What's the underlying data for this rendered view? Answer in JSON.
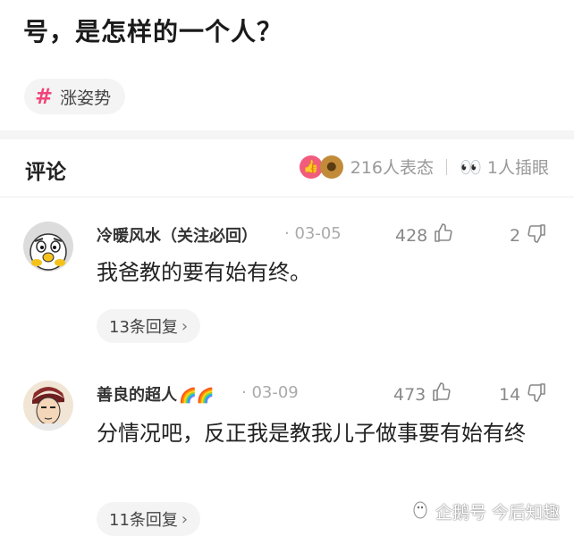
{
  "post": {
    "title": "号，是怎样的一个人？"
  },
  "tag": {
    "icon": "hash-icon",
    "label": "涨姿势"
  },
  "comments_header": {
    "title": "评论",
    "reaction_count": "216人表态",
    "insert_eye_count": "1人插眼"
  },
  "comments": [
    {
      "user": "冷暖风水（关注必回）",
      "date": "· 03-05",
      "likes": "428",
      "dislikes": "2",
      "text": "我爸教的要有始有终。",
      "replies": "13条回复",
      "avatar_icon": "cartoon-chick-avatar"
    },
    {
      "user": "善良的超人",
      "date": "· 03-09",
      "likes": "473",
      "dislikes": "14",
      "text": "分情况吧，反正我是教我儿子做事要有始有终",
      "replies": "11条回复",
      "avatar_icon": "anime-character-avatar"
    }
  ],
  "watermark": {
    "text": "企鹅号 今后知趣"
  },
  "colors": {
    "accent": "#f0457a",
    "muted": "#999999",
    "pill_bg": "#f4f4f4"
  }
}
